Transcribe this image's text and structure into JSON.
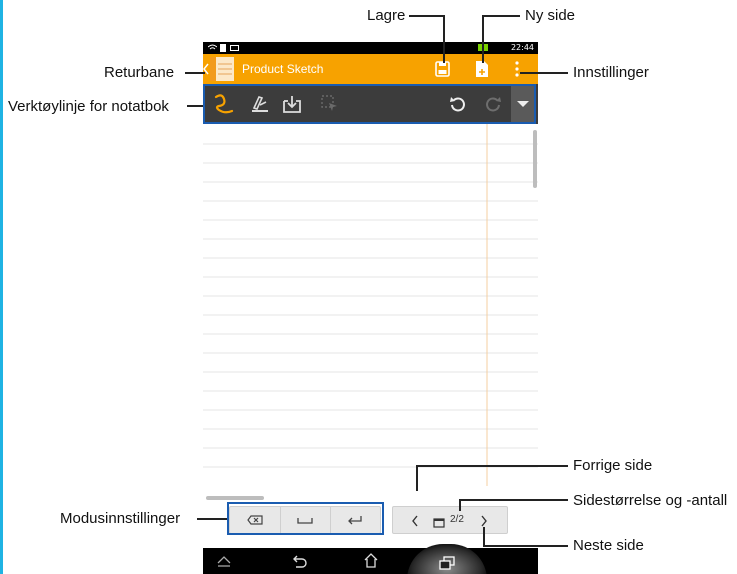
{
  "app": {
    "title": "Product Sketch"
  },
  "status": {
    "time": "22:44"
  },
  "callouts": {
    "save": "Lagre",
    "new_page": "Ny side",
    "return_bar": "Returbane",
    "settings": "Innstillinger",
    "notebook_toolbar": "Verktøylinje for notatbok",
    "previous_page": "Forrige side",
    "page_size_count": "Sidestørrelse og -antall",
    "next_page": "Neste side",
    "mode_settings": "Modusinnstillinger"
  },
  "pager": {
    "count": "2/2"
  },
  "icons": {
    "app": "notebook-icon",
    "save": "save-icon",
    "new_page": "new-page-icon",
    "menu": "overflow-menu-icon",
    "pen": "pen-tool-icon",
    "highlighter": "highlighter-icon",
    "insert": "insert-icon",
    "select": "select-icon",
    "undo": "undo-icon",
    "redo": "redo-icon",
    "expand": "expand-toolbar-icon",
    "backspace": "backspace-icon",
    "space": "space-icon",
    "enter": "enter-icon",
    "prev": "chevron-left-icon",
    "page_size": "page-size-icon",
    "next": "chevron-right-icon",
    "nav_back": "back-icon",
    "nav_home": "home-icon",
    "nav_recent": "recent-apps-icon",
    "nav_up": "chevron-up-icon"
  },
  "colors": {
    "action_bar": "#f7a200",
    "toolbar": "#3c3c3c",
    "accent_frame": "#1a5cb0",
    "pen_active": "#f7a200"
  }
}
